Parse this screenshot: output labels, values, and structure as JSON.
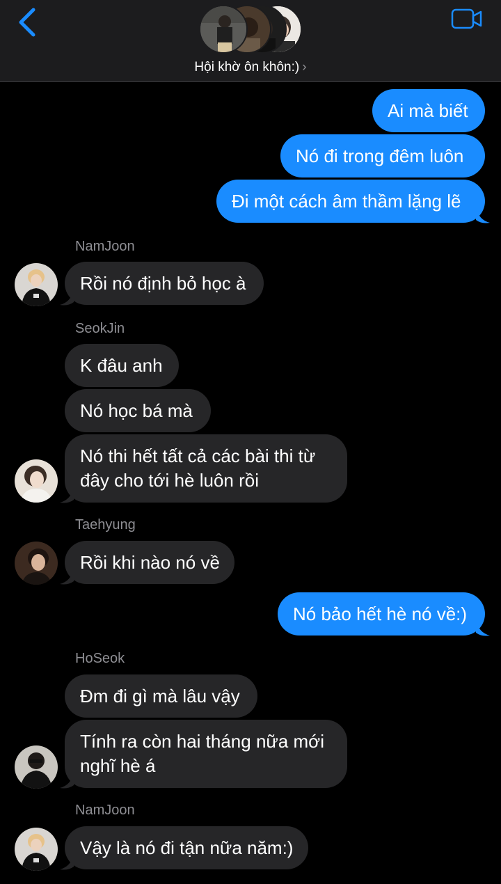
{
  "header": {
    "group_name": "Hội khờ ôn khôn:)",
    "chevron": "›",
    "back_icon": "chevron-left-icon",
    "video_icon": "video-camera-icon",
    "accent": "#1a8cff"
  },
  "messages": [
    {
      "dir": "out",
      "text": "Ai mà biết"
    },
    {
      "dir": "out",
      "text": "Nó đi trong đêm luôn"
    },
    {
      "dir": "out",
      "text": "Đi một cách âm thầm lặng lẽ"
    },
    {
      "sender": "NamJoon"
    },
    {
      "dir": "in",
      "text": "Rồi nó định bỏ học à"
    },
    {
      "sender": "SeokJin"
    },
    {
      "dir": "in",
      "text": "K đâu anh"
    },
    {
      "dir": "in",
      "text": "Nó học bá mà"
    },
    {
      "dir": "in",
      "text": "Nó thi hết tất cả các bài thi từ đây cho tới hè luôn rồi"
    },
    {
      "sender": "Taehyung"
    },
    {
      "dir": "in",
      "text": "Rồi khi nào nó về"
    },
    {
      "dir": "out",
      "text": "Nó bảo hết hè nó về:)"
    },
    {
      "sender": "HoSeok"
    },
    {
      "dir": "in",
      "text": "Đm đi gì mà lâu vậy"
    },
    {
      "dir": "in",
      "text": "Tính ra còn hai tháng nữa mới nghĩ hè á"
    },
    {
      "sender": "NamJoon"
    },
    {
      "dir": "in",
      "text": "Vậy là nó đi tận nữa năm:)"
    }
  ]
}
